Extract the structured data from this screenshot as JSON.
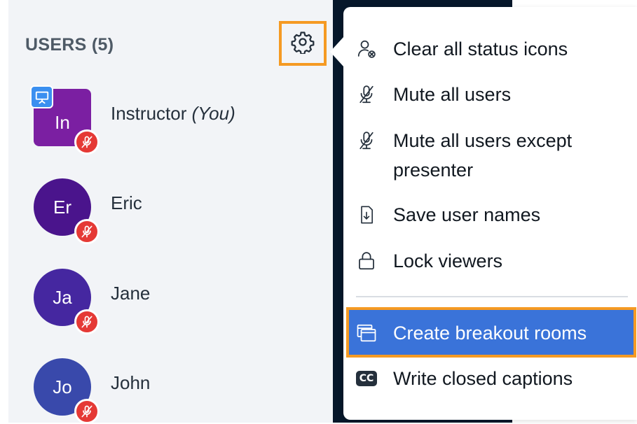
{
  "users_panel": {
    "header": "USERS (5)",
    "users": [
      {
        "initials": "In",
        "name": "Instructor",
        "suffix": "(You)",
        "presenter": true,
        "muted": true,
        "color": "#7b1fa2"
      },
      {
        "initials": "Er",
        "name": "Eric",
        "muted": true,
        "color": "#4a148c"
      },
      {
        "initials": "Ja",
        "name": "Jane",
        "muted": true,
        "color": "#4527a0"
      },
      {
        "initials": "Jo",
        "name": "John",
        "muted": true,
        "color": "#3949ab"
      }
    ]
  },
  "settings_menu": {
    "items": [
      {
        "label": "Clear all status icons",
        "icon": "user-clear-icon"
      },
      {
        "label": "Mute all users",
        "icon": "mic-off-icon"
      },
      {
        "label": "Mute all users except presenter",
        "icon": "mic-off-icon"
      },
      {
        "label": "Save user names",
        "icon": "file-download-icon"
      },
      {
        "label": "Lock viewers",
        "icon": "lock-icon"
      },
      {
        "label": "Create breakout rooms",
        "icon": "breakout-rooms-icon",
        "highlighted": true
      },
      {
        "label": "Write closed captions",
        "icon": "cc-icon"
      }
    ]
  },
  "colors": {
    "highlight_border": "#f59a23",
    "selected_item_bg": "#3a73d9",
    "mute_badge": "#e53935",
    "presenter_badge": "#3a8ff0"
  }
}
